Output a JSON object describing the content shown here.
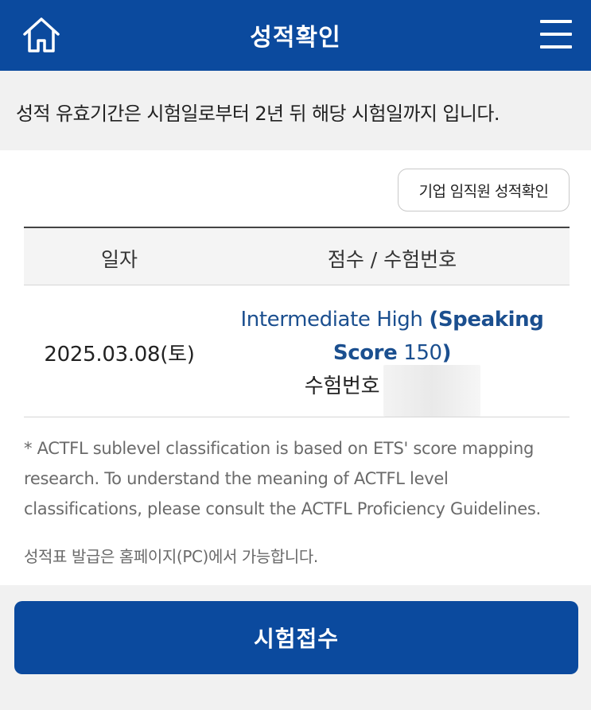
{
  "header": {
    "title": "성적확인",
    "home_icon": "home-icon",
    "menu_icon": "hamburger-menu-icon",
    "brand_color": "#0b4a9e"
  },
  "notice": {
    "text": "성적 유효기간은 시험일로부터 2년 뒤 해당 시험일까지 입니다."
  },
  "corp_button": {
    "label": "기업 임직원 성적확인"
  },
  "table": {
    "headers": {
      "date": "일자",
      "score": "점수 / 수험번호"
    },
    "rows": [
      {
        "date": "2025.03.08(토)",
        "level_prefix": "Intermediate High ",
        "paren_open": "(Speaking",
        "score_word": "Score",
        "score_value": " 150",
        "paren_close": ")",
        "reg_label": "수험번호"
      }
    ]
  },
  "footnote": {
    "line1": "* ACTFL sublevel classification is based on ETS' score mapping",
    "line2": "research. To understand the meaning of ACTFL level",
    "line3": "classifications, please consult the ACTFL Proficiency Guidelines."
  },
  "issue_note": "성적표 발급은 홈페이지(PC)에서 가능합니다.",
  "apply_button": {
    "label": "시험접수"
  }
}
